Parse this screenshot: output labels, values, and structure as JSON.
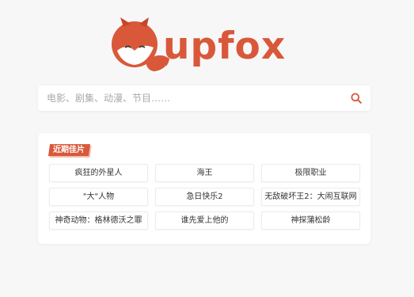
{
  "logo": {
    "text": "upfox",
    "icon": "fox-logo-icon"
  },
  "search": {
    "placeholder": "电影、剧集、动漫、节目……",
    "value": "",
    "icon": "search-icon"
  },
  "recent": {
    "title": "近期佳片",
    "items": [
      "疯狂的外星人",
      "海王",
      "极限职业",
      "\"大\"人物",
      "急日快乐2",
      "无敌破坏王2：大闹互联网",
      "神奇动物：格林德沃之罪",
      "谁先爱上他的",
      "神探蒲松龄"
    ]
  },
  "colors": {
    "accent": "#d9583a",
    "background": "#f7f7f7"
  }
}
